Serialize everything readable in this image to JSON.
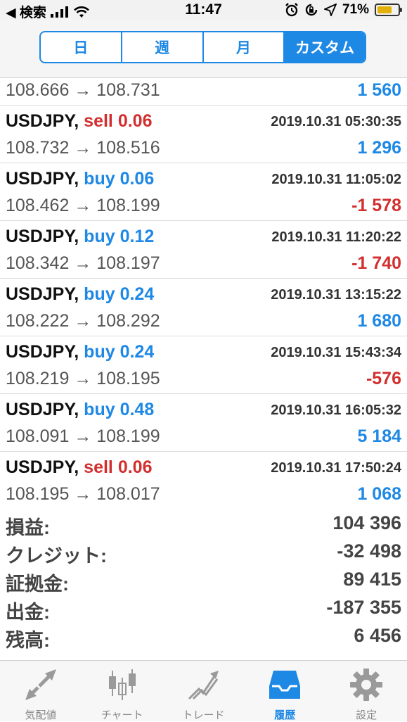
{
  "status_bar": {
    "back_label": "◀ 検索",
    "time": "11:47",
    "battery_text": "71%",
    "battery_level": 0.71
  },
  "period_tabs": [
    "日",
    "週",
    "月",
    "カスタム"
  ],
  "active_period": 3,
  "trades": [
    {
      "symbol": "",
      "side": "",
      "side_class": "",
      "time": "",
      "prices": "108.666 → 108.731",
      "profit": "1 560",
      "profit_class": "pos"
    },
    {
      "symbol": "USDJPY,",
      "side": "sell 0.06",
      "side_class": "sell",
      "time": "2019.10.31 05:30:35",
      "prices": "108.732 → 108.516",
      "profit": "1 296",
      "profit_class": "pos"
    },
    {
      "symbol": "USDJPY,",
      "side": "buy 0.06",
      "side_class": "buy",
      "time": "2019.10.31 11:05:02",
      "prices": "108.462 → 108.199",
      "profit": "-1 578",
      "profit_class": "neg"
    },
    {
      "symbol": "USDJPY,",
      "side": "buy 0.12",
      "side_class": "buy",
      "time": "2019.10.31 11:20:22",
      "prices": "108.342 → 108.197",
      "profit": "-1 740",
      "profit_class": "neg"
    },
    {
      "symbol": "USDJPY,",
      "side": "buy 0.24",
      "side_class": "buy",
      "time": "2019.10.31 13:15:22",
      "prices": "108.222 → 108.292",
      "profit": "1 680",
      "profit_class": "pos"
    },
    {
      "symbol": "USDJPY,",
      "side": "buy 0.24",
      "side_class": "buy",
      "time": "2019.10.31 15:43:34",
      "prices": "108.219 → 108.195",
      "profit": "-576",
      "profit_class": "neg"
    },
    {
      "symbol": "USDJPY,",
      "side": "buy 0.48",
      "side_class": "buy",
      "time": "2019.10.31 16:05:32",
      "prices": "108.091 → 108.199",
      "profit": "5 184",
      "profit_class": "pos"
    },
    {
      "symbol": "USDJPY,",
      "side": "sell 0.06",
      "side_class": "sell",
      "time": "2019.10.31 17:50:24",
      "prices": "108.195 → 108.017",
      "profit": "1 068",
      "profit_class": "pos"
    }
  ],
  "summary": [
    {
      "label": "損益:",
      "value": "104 396"
    },
    {
      "label": "クレジット:",
      "value": "-32 498"
    },
    {
      "label": "証拠金:",
      "value": "89 415"
    },
    {
      "label": "出金:",
      "value": "-187 355"
    },
    {
      "label": "残高:",
      "value": "6 456"
    }
  ],
  "tabbar": [
    {
      "label": "気配値",
      "icon": "quotes-arrows-icon"
    },
    {
      "label": "チャート",
      "icon": "candlestick-chart-icon"
    },
    {
      "label": "トレード",
      "icon": "trade-trend-icon"
    },
    {
      "label": "履歴",
      "icon": "history-inbox-icon"
    },
    {
      "label": "設定",
      "icon": "gear-icon"
    }
  ],
  "active_tab": 3,
  "colors": {
    "accent": "#1e88e5",
    "sell": "#d32f2f",
    "loss": "#d32f2f",
    "battery": "#e2b007"
  }
}
